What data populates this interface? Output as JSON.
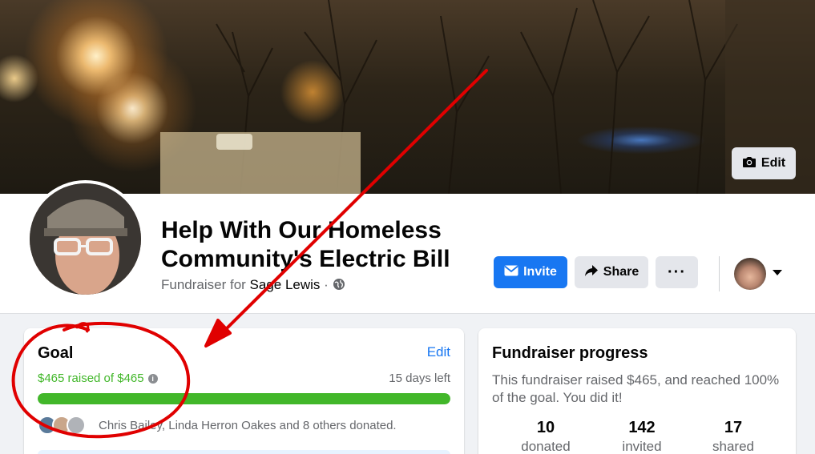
{
  "cover": {
    "edit_label": "Edit",
    "edit_icon": "camera-icon"
  },
  "header": {
    "title": "Help With Our Homeless Community's Electric Bill",
    "subtitle_prefix": "Fundraiser for ",
    "subtitle_name": "Sage Lewis",
    "subtitle_sep": " · ",
    "privacy_icon": "globe-icon",
    "invite_label": "Invite",
    "share_label": "Share",
    "more_label": "···"
  },
  "goal": {
    "title": "Goal",
    "edit_label": "Edit",
    "raised_text": "$465 raised of $465",
    "days_left": "15 days left",
    "progress_fraction": 1.0,
    "donated_text": "Chris Bailey, Linda Herron Oakes and 8 others donated."
  },
  "progress": {
    "title": "Fundraiser progress",
    "summary": "This fundraiser raised $465, and reached 100% of the goal. You did it!",
    "stats": [
      {
        "num": "10",
        "label": "donated"
      },
      {
        "num": "142",
        "label": "invited"
      },
      {
        "num": "17",
        "label": "shared"
      }
    ]
  },
  "colors": {
    "accent": "#1877f2",
    "progress": "#42b72a",
    "annotation": "#e00000"
  }
}
